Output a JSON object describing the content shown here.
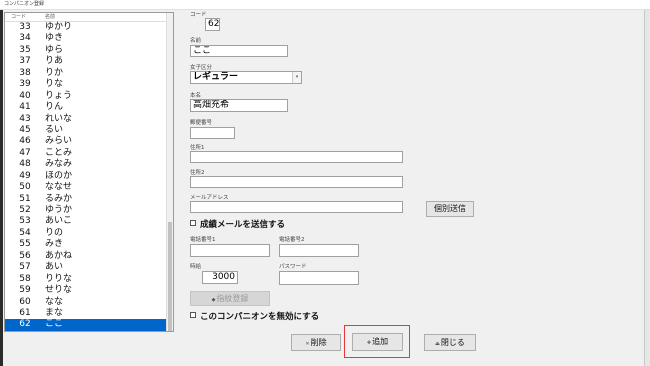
{
  "window": {
    "title": "コンパニオン登録"
  },
  "list": {
    "headers": [
      "コード",
      "名前"
    ],
    "rows": [
      {
        "code": "33",
        "name": "ゆかり"
      },
      {
        "code": "34",
        "name": "ゆき"
      },
      {
        "code": "35",
        "name": "ゆら"
      },
      {
        "code": "37",
        "name": "りあ"
      },
      {
        "code": "38",
        "name": "りか"
      },
      {
        "code": "39",
        "name": "りな"
      },
      {
        "code": "40",
        "name": "りょう"
      },
      {
        "code": "41",
        "name": "りん"
      },
      {
        "code": "43",
        "name": "れいな"
      },
      {
        "code": "45",
        "name": "るい"
      },
      {
        "code": "46",
        "name": "みらい"
      },
      {
        "code": "47",
        "name": "ことみ"
      },
      {
        "code": "48",
        "name": "みなみ"
      },
      {
        "code": "49",
        "name": "ほのか"
      },
      {
        "code": "50",
        "name": "ななせ"
      },
      {
        "code": "51",
        "name": "るみか"
      },
      {
        "code": "52",
        "name": "ゆうか"
      },
      {
        "code": "53",
        "name": "あいこ"
      },
      {
        "code": "54",
        "name": "りの"
      },
      {
        "code": "55",
        "name": "みき"
      },
      {
        "code": "56",
        "name": "あかね"
      },
      {
        "code": "57",
        "name": "あい"
      },
      {
        "code": "58",
        "name": "りりな"
      },
      {
        "code": "59",
        "name": "せりな"
      },
      {
        "code": "60",
        "name": "なな"
      },
      {
        "code": "61",
        "name": "まな"
      },
      {
        "code": "62",
        "name": "ここ"
      }
    ],
    "selected_code": "62"
  },
  "form": {
    "code_label": "コード",
    "code_value": "62",
    "name_label": "名前",
    "name_value": "ここ",
    "category_label": "女子区分",
    "category_value": "レギュラー",
    "realname_label": "本名",
    "realname_value": "高畑充希",
    "zip_label": "郵便番号",
    "zip_value": "",
    "address1_label": "住所1",
    "address1_value": "",
    "address2_label": "住所2",
    "address2_value": "",
    "email_label": "メールアドレス",
    "email_value": "",
    "send_individual_label": "個別送信",
    "send_score_mail_label": "成績メールを送信する",
    "phone1_label": "電話番号1",
    "phone1_value": "",
    "phone2_label": "電話番号2",
    "phone2_value": "",
    "salary_label": "時給",
    "salary_value": "3000",
    "password_label": "パスワード",
    "password_value": "",
    "fingerprint_label": "指紋登録",
    "disable_label": "このコンパニオンを無効にする"
  },
  "buttons": {
    "delete": "削除",
    "add": "追加",
    "close": "閉じる"
  },
  "colors": {
    "selection": "#0066cc",
    "highlight": "#e53935"
  }
}
